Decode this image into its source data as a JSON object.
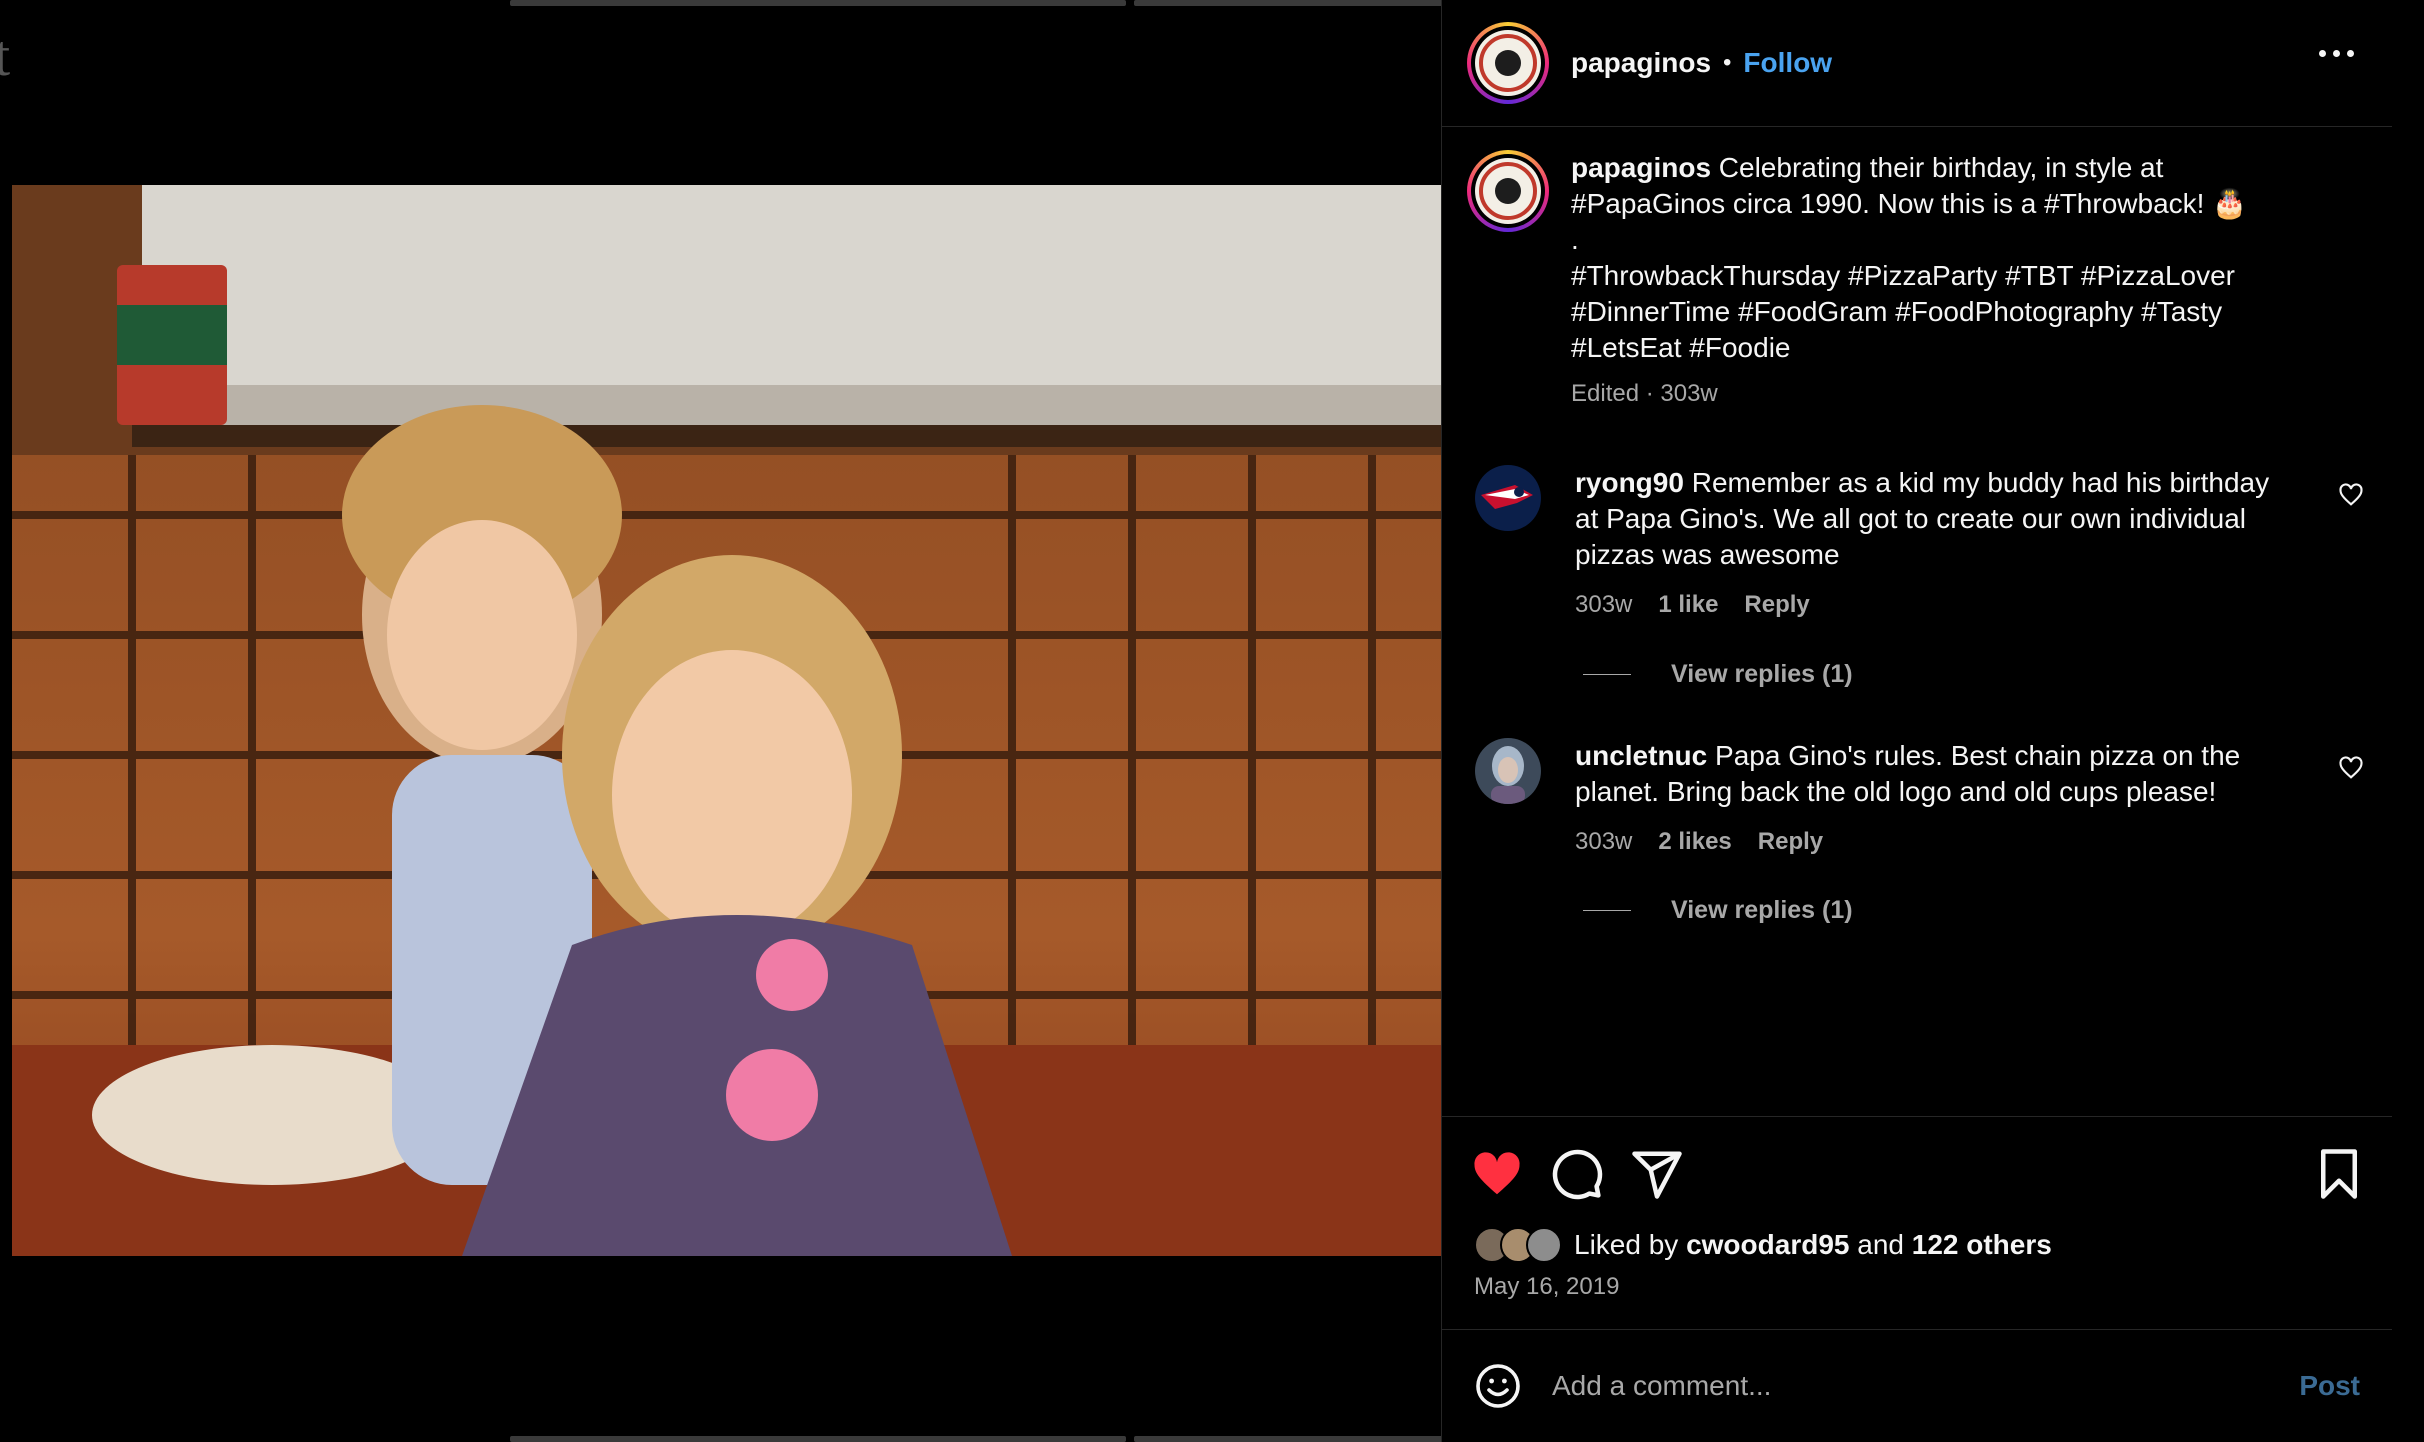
{
  "background_glyph": "t",
  "post": {
    "username": "papaginos",
    "follow_label": "Follow",
    "separator": "•",
    "caption_lines": [
      "Celebrating their birthday, in style at",
      "#PapaGinos circa 1990. Now this is a #Throwback! 🎂",
      ".",
      "#ThrowbackThursday #PizzaParty #TBT #PizzaLover",
      "#DinnerTime #FoodGram #FoodPhotography #Tasty",
      "#LetsEat #Foodie"
    ],
    "caption_meta": "Edited · 303w"
  },
  "comments": [
    {
      "username": "ryong90",
      "text": "Remember as a kid my buddy had his birthday at Papa Gino's. We all got to create our own individual pizzas was awesome",
      "age": "303w",
      "likes": "1 like",
      "reply_label": "Reply",
      "view_replies": "View replies (1)"
    },
    {
      "username": "uncletnuc",
      "text": "Papa Gino's rules. Best chain pizza on the planet. Bring back the old logo and old cups please!",
      "age": "303w",
      "likes": "2 likes",
      "reply_label": "Reply",
      "view_replies": "View replies (1)"
    }
  ],
  "engagement": {
    "liked_prefix": "Liked by",
    "liked_user": "cwoodard95",
    "liked_and": "and",
    "liked_others": "122 others",
    "date": "May 16, 2019",
    "liked": true
  },
  "comment_box": {
    "placeholder": "Add a comment...",
    "post_label": "Post"
  },
  "icons": {
    "like": "heart-filled-icon",
    "comment": "comment-bubble-icon",
    "share": "paper-plane-icon",
    "save": "bookmark-icon",
    "more": "more-horizontal-icon",
    "emoji": "emoji-smiley-icon"
  },
  "colors": {
    "accent_link": "#4aa3f0",
    "heart": "#ff3040",
    "muted": "#a8a8a8",
    "post_disabled": "#3b6b94"
  }
}
